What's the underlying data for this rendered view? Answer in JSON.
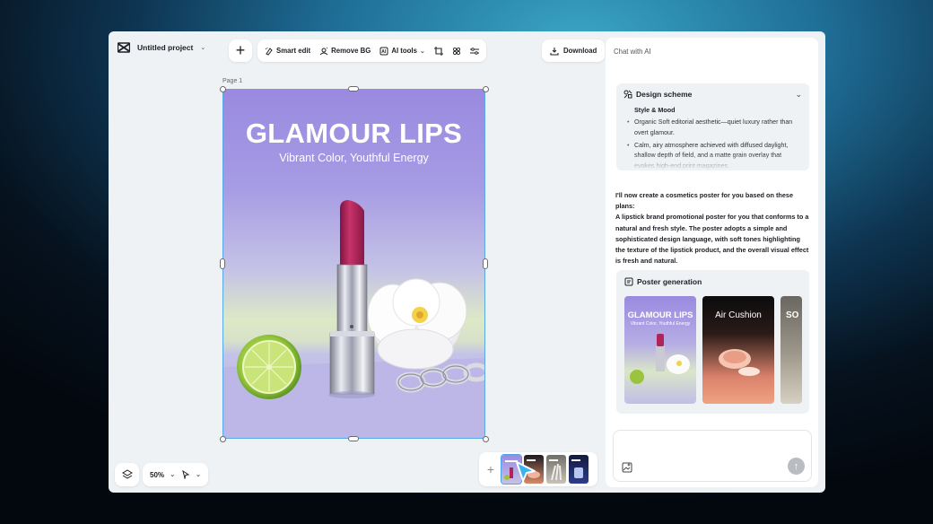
{
  "header": {
    "project_title": "Untitled project",
    "toolbar": {
      "smart_edit": "Smart edit",
      "remove_bg": "Remove BG",
      "ai_tools": "AI tools"
    },
    "download": "Download"
  },
  "canvas": {
    "page_label": "Page 1",
    "poster": {
      "title": "GLAMOUR LIPS",
      "subtitle": "Vibrant Color, Youthful Energy"
    }
  },
  "bottom": {
    "zoom": "50%"
  },
  "chat": {
    "title": "Chat with AI",
    "design_scheme": {
      "heading": "Design scheme",
      "subheading": "Style & Mood",
      "items": [
        "Organic Soft editorial aesthetic—quiet luxury rather than overt glamour.",
        "Calm, airy atmosphere achieved with diffused daylight, shallow depth of field, and a matte grain overlay that evokes high-end print magazines."
      ]
    },
    "message_intro": "I'll now create a cosmetics poster for you based on these plans:",
    "message_body": "A lipstick brand promotional poster for you that conforms to a natural and fresh style. The poster adopts a simple and sophisticated design language, with soft tones highlighting the texture of the lipstick product, and the overall visual effect is fresh and natural.",
    "poster_generation": {
      "heading": "Poster generation",
      "cards": [
        {
          "title": "GLAMOUR LIPS",
          "subtitle": "Vibrant Color, Youthful Energy"
        },
        {
          "title": "Air Cushion"
        },
        {
          "title": "SO"
        }
      ]
    }
  },
  "colors": {
    "accent": "#4ea4e8",
    "poster_top": "#9a8ae0",
    "lipstick": "#b0245a"
  }
}
